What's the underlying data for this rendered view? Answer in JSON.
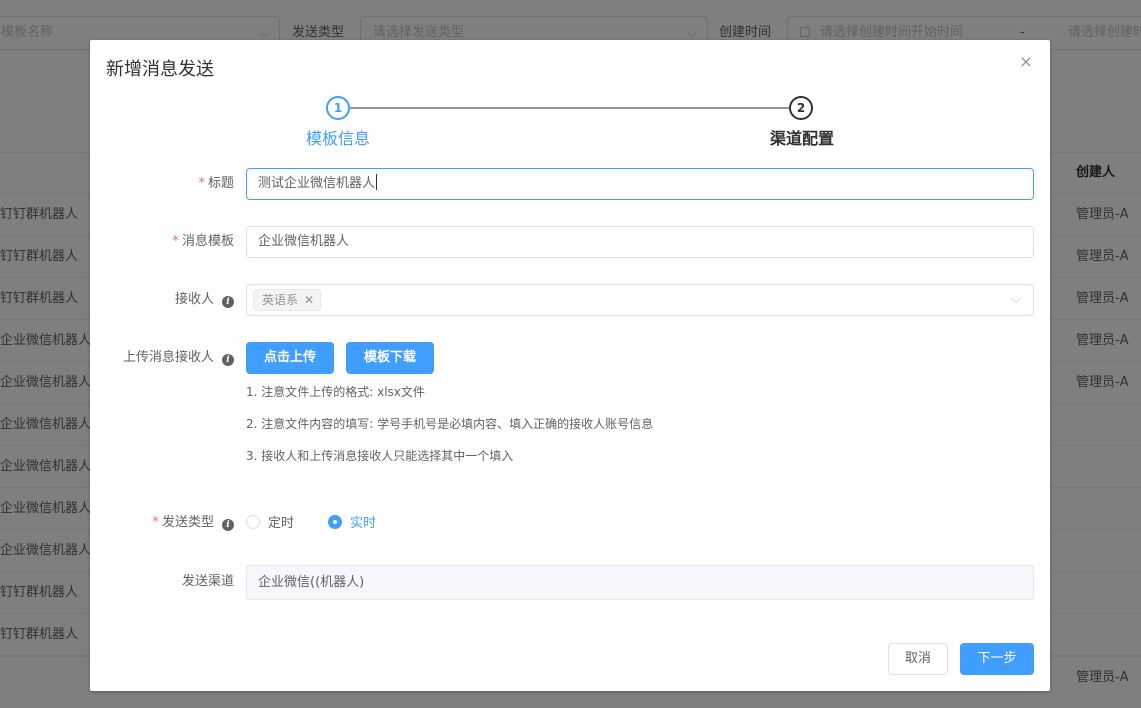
{
  "filters": {
    "template_name_placeholder": "模板名称",
    "send_type_label": "发送类型",
    "send_type_placeholder": "请选择发送类型",
    "created_label": "创建时间",
    "created_start_placeholder": "请选择创建时间开始时间",
    "range_separator": "-",
    "created_end_placeholder": "请选择创建时间"
  },
  "table": {
    "creator_header": "创建人",
    "rows": [
      {
        "name": "钉钉群机器人",
        "creator": "管理员-A"
      },
      {
        "name": "钉钉群机器人",
        "creator": "管理员-A"
      },
      {
        "name": "钉钉群机器人",
        "creator": "管理员-A"
      },
      {
        "name": "企业微信机器人",
        "creator": "管理员-A"
      },
      {
        "name": "企业微信机器人",
        "creator": "管理员-A"
      },
      {
        "name": "企业微信机器人",
        "creator": ""
      },
      {
        "name": "企业微信机器人",
        "creator": ""
      },
      {
        "name": "企业微信机器人",
        "creator": ""
      },
      {
        "name": "企业微信机器人",
        "creator": ""
      },
      {
        "name": "钉钉群机器人",
        "creator": ""
      },
      {
        "name": "钉钉群机器人",
        "creator": ""
      }
    ],
    "last_row_creator": "管理员-A"
  },
  "dialog": {
    "title": "新增消息发送",
    "close_glyph": "×",
    "steps": [
      {
        "number": "1",
        "label": "模板信息",
        "state": "active"
      },
      {
        "number": "2",
        "label": "渠道配置",
        "state": "pending"
      }
    ],
    "form": {
      "title_label": "标题",
      "title_value": "测试企业微信机器人",
      "template_label": "消息模板",
      "template_value": "企业微信机器人",
      "receiver_label": "接收人",
      "receiver_tags": [
        "英语系"
      ],
      "upload_label": "上传消息接收人",
      "upload_button": "点击上传",
      "download_button": "模板下载",
      "notes": [
        "1. 注意文件上传的格式: xlsx文件",
        "2. 注意文件内容的填写: 学号手机号是必填内容、填入正确的接收人账号信息",
        "3. 接收人和上传消息接收人只能选择其中一个填入"
      ],
      "send_type_label": "发送类型",
      "send_type_options": [
        {
          "label": "定时",
          "checked": false
        },
        {
          "label": "实时",
          "checked": true
        }
      ],
      "channel_label": "发送渠道",
      "channel_value": "企业微信((机器人)"
    },
    "footer": {
      "cancel": "取消",
      "next": "下一步"
    }
  },
  "colors": {
    "primary": "#409eff",
    "required": "#f56c6c",
    "overlay": "rgba(0,0,0,0.5)"
  }
}
